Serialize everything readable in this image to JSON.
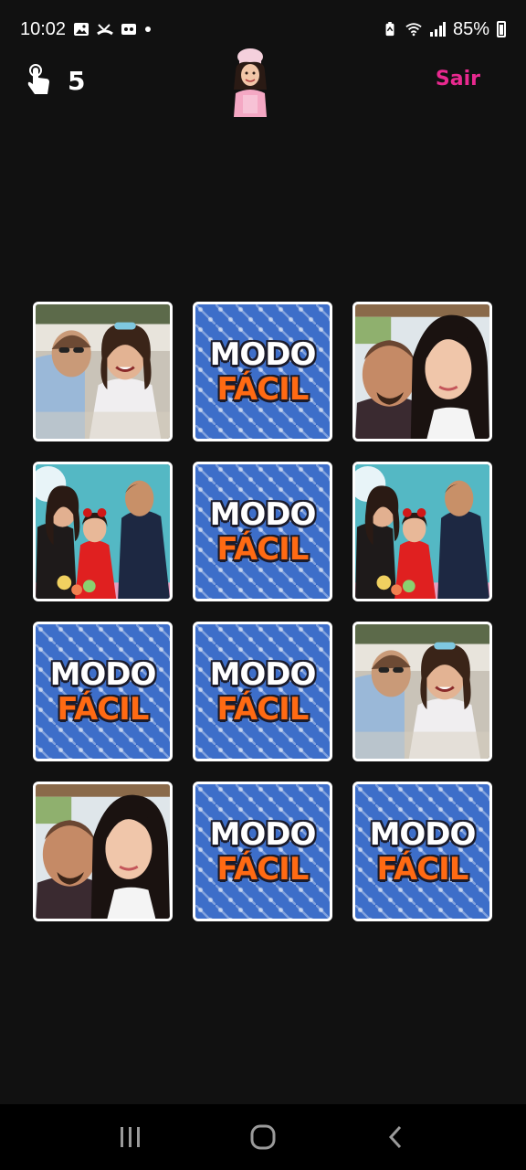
{
  "status_bar": {
    "time": "10:02",
    "battery": "85%",
    "icons": [
      "gallery-icon",
      "missed-call-icon",
      "voicemail-icon",
      "dot-icon",
      "battery-saver-icon",
      "wifi-icon",
      "signal-icon",
      "battery-icon"
    ]
  },
  "header": {
    "moves_icon": "tap-hand-icon",
    "moves": "5",
    "avatar": "player-avatar-chef-girl",
    "exit_label": "Sair"
  },
  "colors": {
    "background": "#111111",
    "accent": "#e8298f",
    "card_back": "#3d6ec9",
    "card_text_top": "#ffffff",
    "card_text_bottom": "#ff6a13"
  },
  "board": {
    "card_back_text": [
      "MODO",
      "FÁCIL"
    ],
    "cards": [
      {
        "state": "face-up",
        "photo": "grandma-and-girl"
      },
      {
        "state": "face-down"
      },
      {
        "state": "face-up",
        "photo": "couple-selfie"
      },
      {
        "state": "face-up",
        "photo": "family-with-girl-red-dress"
      },
      {
        "state": "face-down"
      },
      {
        "state": "face-up",
        "photo": "family-with-girl-red-dress"
      },
      {
        "state": "face-down"
      },
      {
        "state": "face-down"
      },
      {
        "state": "face-up",
        "photo": "grandma-and-girl"
      },
      {
        "state": "face-up",
        "photo": "couple-selfie"
      },
      {
        "state": "face-down"
      },
      {
        "state": "face-down"
      }
    ]
  },
  "nav": {
    "buttons": [
      "recent-apps-icon",
      "home-icon",
      "back-icon"
    ]
  }
}
